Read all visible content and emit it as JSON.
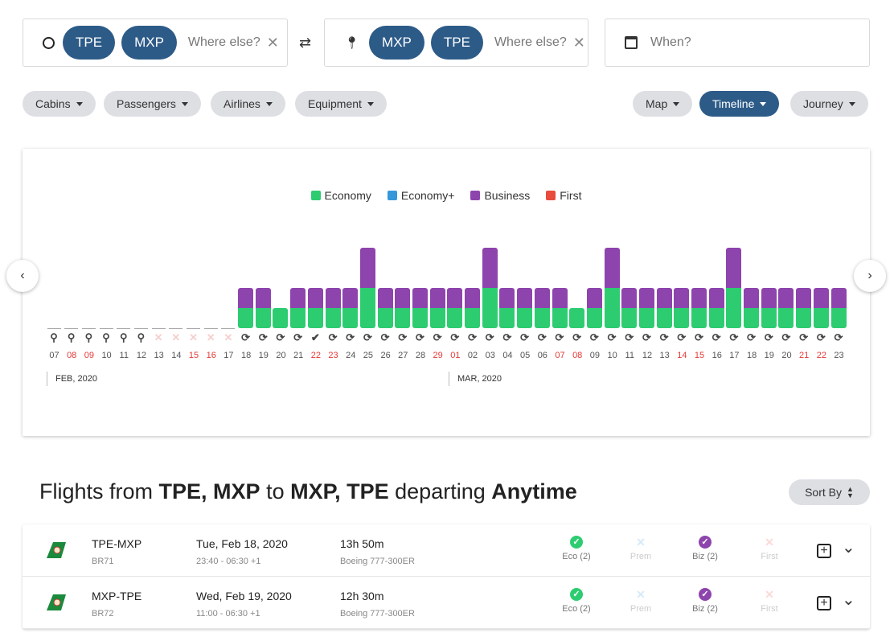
{
  "search": {
    "origin": {
      "icon": "circle-icon",
      "chips": [
        "TPE",
        "MXP"
      ],
      "placeholder": "Where else?"
    },
    "destination": {
      "icon": "map-pin-icon",
      "chips": [
        "MXP",
        "TPE"
      ],
      "placeholder": "Where else?"
    },
    "swap_icon": "swap-arrows-icon",
    "date": {
      "icon": "calendar-icon",
      "placeholder": "When?"
    }
  },
  "filters": [
    "Cabins",
    "Passengers",
    "Airlines",
    "Equipment"
  ],
  "views": [
    {
      "label": "Map",
      "active": false
    },
    {
      "label": "Timeline",
      "active": true
    },
    {
      "label": "Journey",
      "active": false
    }
  ],
  "chart_data": {
    "type": "bar",
    "stacked": true,
    "legend": [
      {
        "name": "Economy",
        "color": "#2ecc71"
      },
      {
        "name": "Economy+",
        "color": "#3498db"
      },
      {
        "name": "Business",
        "color": "#8e44ad"
      },
      {
        "name": "First",
        "color": "#e74c3c"
      }
    ],
    "legend_placement": "top-center",
    "months": [
      "FEB, 2020",
      "MAR, 2020"
    ],
    "categories": [
      "07",
      "08",
      "09",
      "10",
      "11",
      "12",
      "13",
      "14",
      "15",
      "16",
      "17",
      "18",
      "19",
      "20",
      "21",
      "22",
      "23",
      "24",
      "25",
      "26",
      "27",
      "28",
      "29",
      "01",
      "02",
      "03",
      "04",
      "05",
      "06",
      "07",
      "08",
      "09",
      "10",
      "11",
      "12",
      "13",
      "14",
      "15",
      "16",
      "17",
      "18",
      "19",
      "20",
      "21",
      "22",
      "23"
    ],
    "weekend": [
      false,
      true,
      true,
      false,
      false,
      false,
      false,
      false,
      true,
      true,
      false,
      false,
      false,
      false,
      false,
      true,
      true,
      false,
      false,
      false,
      false,
      false,
      true,
      true,
      false,
      false,
      false,
      false,
      false,
      true,
      true,
      false,
      false,
      false,
      false,
      false,
      true,
      true,
      false,
      false,
      false,
      false,
      false,
      true,
      true,
      false
    ],
    "status": [
      "search",
      "search",
      "search",
      "search",
      "search",
      "search",
      "unavailable",
      "unavailable",
      "unavailable",
      "unavailable",
      "unavailable",
      "refresh",
      "refresh",
      "refresh",
      "refresh",
      "done",
      "refresh",
      "refresh",
      "refresh",
      "refresh",
      "refresh",
      "refresh",
      "refresh",
      "refresh",
      "refresh",
      "refresh",
      "refresh",
      "refresh",
      "refresh",
      "refresh",
      "refresh",
      "refresh",
      "refresh",
      "refresh",
      "refresh",
      "refresh",
      "refresh",
      "refresh",
      "refresh",
      "refresh",
      "refresh",
      "refresh",
      "refresh",
      "refresh",
      "refresh",
      "refresh"
    ],
    "series": [
      {
        "name": "Economy",
        "values": [
          0,
          0,
          0,
          0,
          0,
          0,
          0,
          0,
          0,
          0,
          0,
          1,
          1,
          1,
          1,
          1,
          1,
          1,
          2,
          1,
          1,
          1,
          1,
          1,
          1,
          2,
          1,
          1,
          1,
          1,
          1,
          1,
          2,
          1,
          1,
          1,
          1,
          1,
          1,
          2,
          1,
          1,
          1,
          1,
          1,
          1
        ]
      },
      {
        "name": "Economy+",
        "values": [
          0,
          0,
          0,
          0,
          0,
          0,
          0,
          0,
          0,
          0,
          0,
          0,
          0,
          0,
          0,
          0,
          0,
          0,
          0,
          0,
          0,
          0,
          0,
          0,
          0,
          0,
          0,
          0,
          0,
          0,
          0,
          0,
          0,
          0,
          0,
          0,
          0,
          0,
          0,
          0,
          0,
          0,
          0,
          0,
          0,
          0
        ]
      },
      {
        "name": "Business",
        "values": [
          0,
          0,
          0,
          0,
          0,
          0,
          0,
          0,
          0,
          0,
          0,
          1,
          1,
          0,
          1,
          1,
          1,
          1,
          2,
          1,
          1,
          1,
          1,
          1,
          1,
          2,
          1,
          1,
          1,
          1,
          0,
          1,
          2,
          1,
          1,
          1,
          1,
          1,
          1,
          2,
          1,
          1,
          1,
          1,
          1,
          1
        ]
      },
      {
        "name": "First",
        "values": [
          0,
          0,
          0,
          0,
          0,
          0,
          0,
          0,
          0,
          0,
          0,
          0,
          0,
          0,
          0,
          0,
          0,
          0,
          0,
          0,
          0,
          0,
          0,
          0,
          0,
          0,
          0,
          0,
          0,
          0,
          0,
          0,
          0,
          0,
          0,
          0,
          0,
          0,
          0,
          0,
          0,
          0,
          0,
          0,
          0,
          0
        ]
      }
    ]
  },
  "results": {
    "title_parts": [
      "Flights from ",
      "TPE, MXP",
      " to ",
      "MXP, TPE",
      " departing ",
      "Anytime"
    ],
    "sort_label": "Sort By",
    "flights": [
      {
        "route": "TPE-MXP",
        "flight": "BR71",
        "date": "Tue, Feb 18, 2020",
        "times": "23:40 - 06:30 +1",
        "duration": "13h 50m",
        "aircraft": "Boeing 777-300ER",
        "cabins": [
          {
            "label": "Eco (2)",
            "available": true,
            "color": "#2ecc71"
          },
          {
            "label": "Prem",
            "available": false,
            "color": "#3498db"
          },
          {
            "label": "Biz (2)",
            "available": true,
            "color": "#8e44ad"
          },
          {
            "label": "First",
            "available": false,
            "color": "#e74c3c"
          }
        ]
      },
      {
        "route": "MXP-TPE",
        "flight": "BR72",
        "date": "Wed, Feb 19, 2020",
        "times": "11:00 - 06:30 +1",
        "duration": "12h 30m",
        "aircraft": "Boeing 777-300ER",
        "cabins": [
          {
            "label": "Eco (2)",
            "available": true,
            "color": "#2ecc71"
          },
          {
            "label": "Prem",
            "available": false,
            "color": "#3498db"
          },
          {
            "label": "Biz (2)",
            "available": true,
            "color": "#8e44ad"
          },
          {
            "label": "First",
            "available": false,
            "color": "#e74c3c"
          }
        ]
      }
    ]
  }
}
